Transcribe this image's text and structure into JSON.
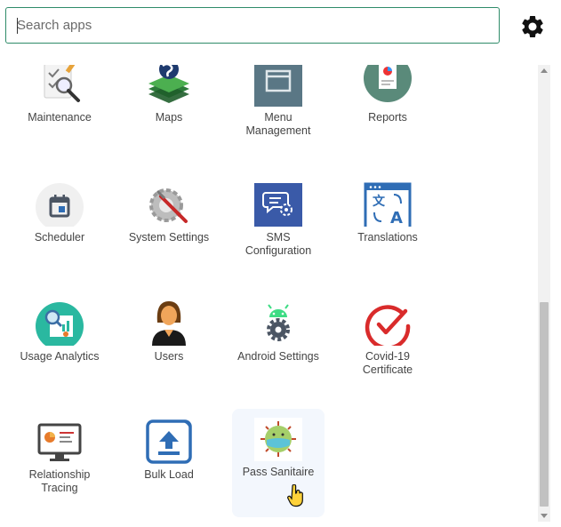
{
  "search": {
    "placeholder": "Search apps",
    "value": ""
  },
  "apps": [
    {
      "label": "Maintenance",
      "icon": "maintenance-icon"
    },
    {
      "label": "Maps",
      "icon": "maps-icon"
    },
    {
      "label": "Menu Management",
      "icon": "menu-management-icon"
    },
    {
      "label": "Reports",
      "icon": "reports-icon"
    },
    {
      "label": "Scheduler",
      "icon": "calendar-icon"
    },
    {
      "label": "System Settings",
      "icon": "system-settings-icon"
    },
    {
      "label": "SMS Configuration",
      "icon": "sms-configuration-icon"
    },
    {
      "label": "Translations",
      "icon": "translations-icon"
    },
    {
      "label": "Usage Analytics",
      "icon": "analytics-icon"
    },
    {
      "label": "Users",
      "icon": "user-icon"
    },
    {
      "label": "Android Settings",
      "icon": "android-icon"
    },
    {
      "label": "Covid-19 Certificate",
      "icon": "checkmark-icon"
    },
    {
      "label": "Relationship Tracing",
      "icon": "relationship-tracing-icon"
    },
    {
      "label": "Bulk Load",
      "icon": "upload-icon"
    },
    {
      "label": "Pass Sanitaire",
      "icon": "virus-mask-icon"
    }
  ],
  "colors": {
    "accent": "#2e8b69",
    "hover_tile": "#f3f7fd",
    "sms_blue": "#3a5aa8",
    "covid_red": "#d92b2b",
    "usage_teal": "#2ab8a0"
  }
}
